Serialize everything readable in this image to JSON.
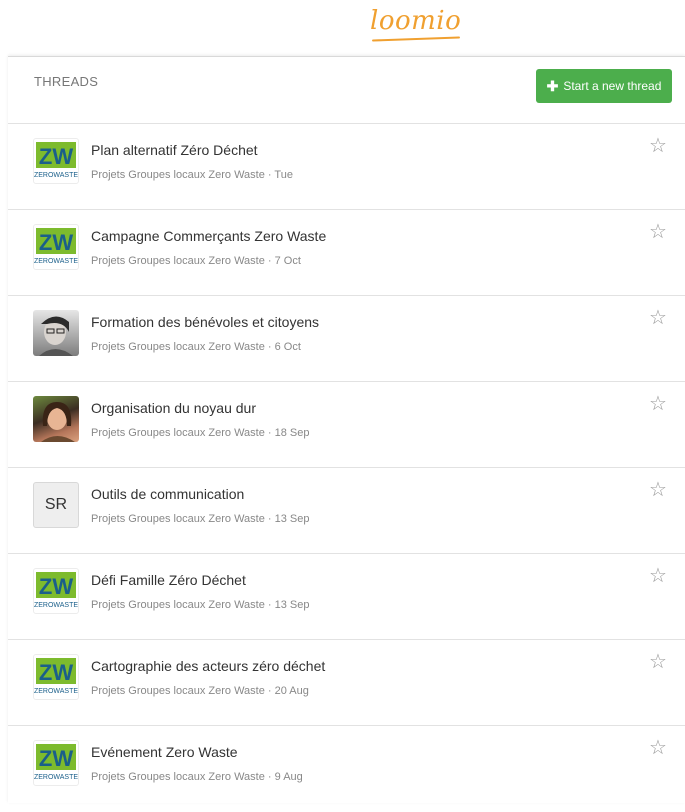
{
  "app": {
    "logo_text": "loomio"
  },
  "header": {
    "title": "THREADS",
    "new_thread_label": "Start a new thread"
  },
  "colors": {
    "brand": "#f0a030",
    "button_green": "#4cae4c"
  },
  "threads": [
    {
      "title": "Plan alternatif Zéro Déchet",
      "group": "Projets Groupes locaux Zero Waste",
      "time": "Tue",
      "avatar": "zerowaste-logo"
    },
    {
      "title": "Campagne Commerçants Zero Waste",
      "group": "Projets Groupes locaux Zero Waste",
      "time": "7 Oct",
      "avatar": "zerowaste-logo"
    },
    {
      "title": "Formation des bénévoles et citoyens",
      "group": "Projets Groupes locaux Zero Waste",
      "time": "6 Oct",
      "avatar": "photo"
    },
    {
      "title": "Organisation du noyau dur",
      "group": "Projets Groupes locaux Zero Waste",
      "time": "18 Sep",
      "avatar": "photo"
    },
    {
      "title": "Outils de communication",
      "group": "Projets Groupes locaux Zero Waste",
      "time": "13 Sep",
      "avatar": "initials",
      "initials": "SR"
    },
    {
      "title": "Défi Famille Zéro Déchet",
      "group": "Projets Groupes locaux Zero Waste",
      "time": "13 Sep",
      "avatar": "zerowaste-logo"
    },
    {
      "title": "Cartographie des acteurs zéro déchet",
      "group": "Projets Groupes locaux Zero Waste",
      "time": "20 Aug",
      "avatar": "zerowaste-logo"
    },
    {
      "title": "Evénement Zero Waste",
      "group": "Projets Groupes locaux Zero Waste",
      "time": "9 Aug",
      "avatar": "zerowaste-logo"
    }
  ],
  "separator": " · ",
  "icons": {
    "star": "star-outline-icon",
    "plus": "plus-icon"
  }
}
